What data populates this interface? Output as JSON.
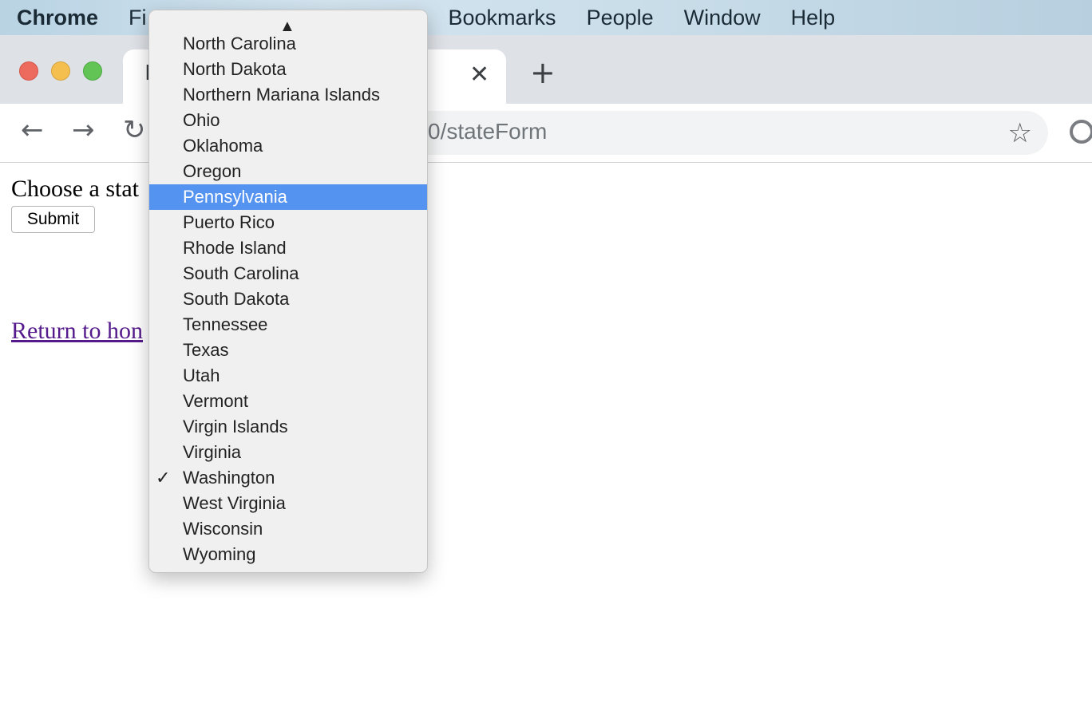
{
  "menubar": {
    "app_name": "Chrome",
    "items": [
      "Fi",
      "Bookmarks",
      "People",
      "Window",
      "Help"
    ]
  },
  "tab": {
    "title": "l",
    "close_glyph": "✕"
  },
  "toolbar": {
    "back_glyph": "←",
    "forward_glyph": "→",
    "reload_glyph": "↻",
    "url": "0/stateForm",
    "star_glyph": "☆",
    "new_tab_glyph": "+"
  },
  "page": {
    "label": "Choose a stat",
    "submit_label": "Submit",
    "home_link": "Return to hon"
  },
  "dropdown": {
    "scroll_up_glyph": "▲",
    "check_glyph": "✓",
    "options": [
      {
        "label": "North Carolina"
      },
      {
        "label": "North Dakota"
      },
      {
        "label": "Northern Mariana Islands"
      },
      {
        "label": "Ohio"
      },
      {
        "label": "Oklahoma"
      },
      {
        "label": "Oregon"
      },
      {
        "label": "Pennsylvania",
        "highlighted": true
      },
      {
        "label": "Puerto Rico"
      },
      {
        "label": "Rhode Island"
      },
      {
        "label": "South Carolina"
      },
      {
        "label": "South Dakota"
      },
      {
        "label": "Tennessee"
      },
      {
        "label": "Texas"
      },
      {
        "label": "Utah"
      },
      {
        "label": "Vermont"
      },
      {
        "label": "Virgin Islands"
      },
      {
        "label": "Virginia"
      },
      {
        "label": "Washington",
        "checked": true
      },
      {
        "label": "West Virginia"
      },
      {
        "label": "Wisconsin"
      },
      {
        "label": "Wyoming"
      }
    ]
  },
  "colors": {
    "highlight": "#5593f0",
    "visited_link": "#551a8b"
  }
}
